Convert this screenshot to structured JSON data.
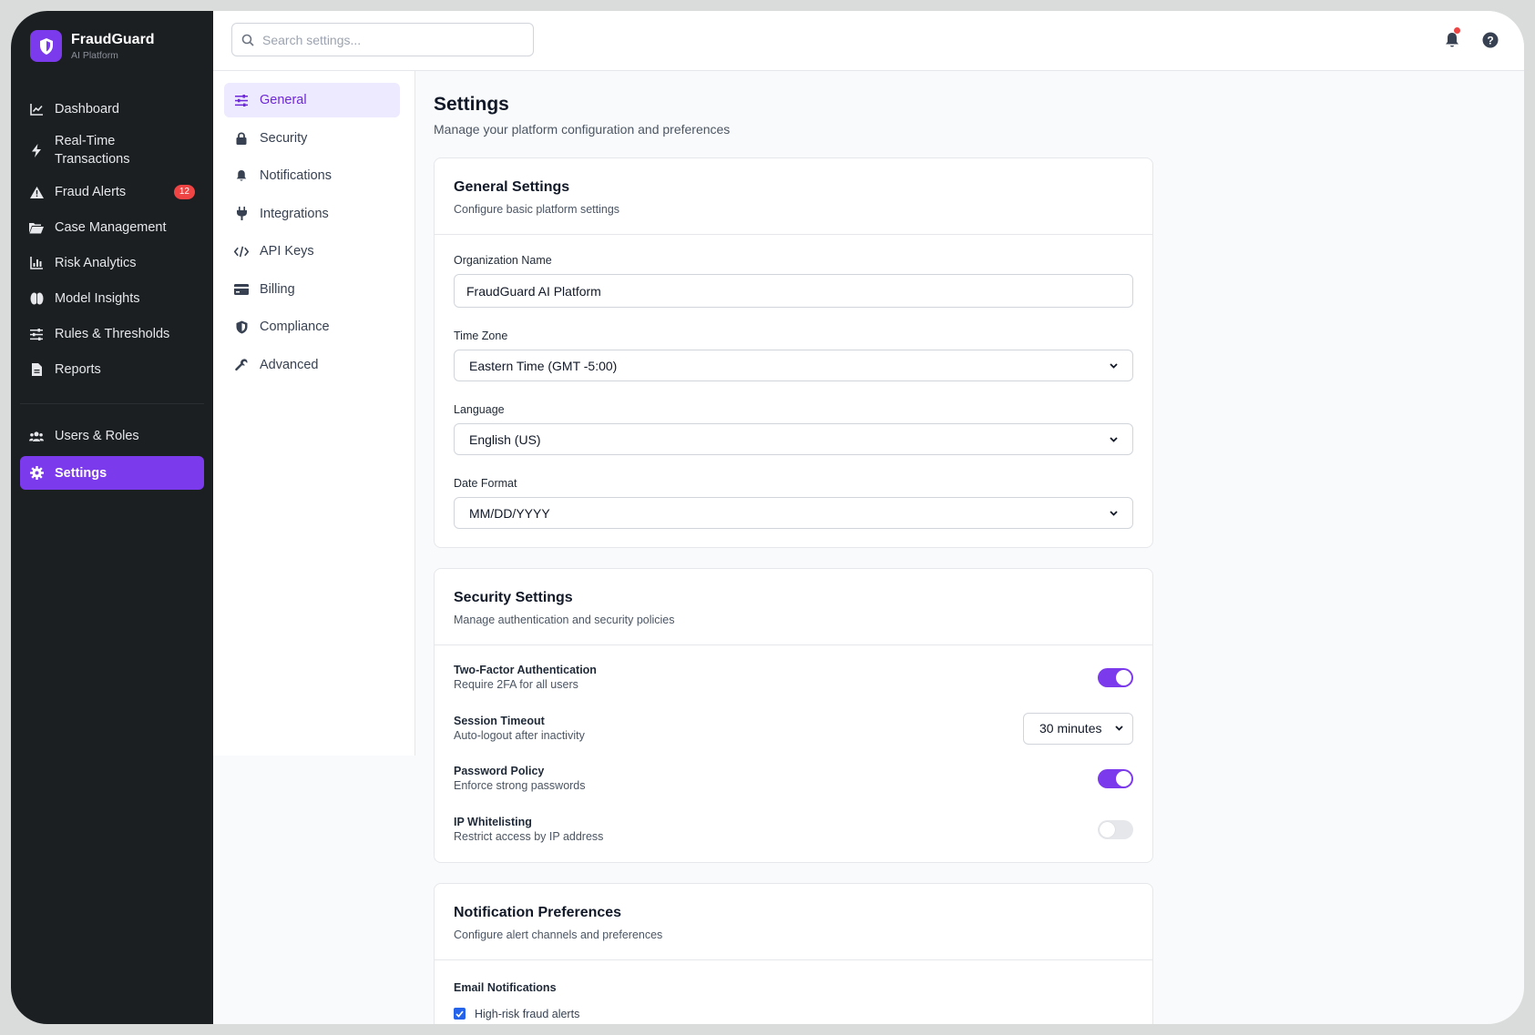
{
  "brand": {
    "name": "FraudGuard",
    "subtitle": "AI Platform"
  },
  "sidebar": {
    "items": [
      {
        "label": "Dashboard",
        "icon": "chart-line-icon"
      },
      {
        "label": "Real-Time\nTransactions",
        "icon": "bolt-icon"
      },
      {
        "label": "Fraud Alerts",
        "icon": "warning-icon",
        "badge": "12"
      },
      {
        "label": "Case Management",
        "icon": "folder-open-icon"
      },
      {
        "label": "Risk Analytics",
        "icon": "bar-chart-icon"
      },
      {
        "label": "Model Insights",
        "icon": "brain-icon"
      },
      {
        "label": "Rules & Thresholds",
        "icon": "sliders-icon"
      },
      {
        "label": "Reports",
        "icon": "file-icon"
      }
    ],
    "bottom_items": [
      {
        "label": "Users & Roles",
        "icon": "users-icon"
      },
      {
        "label": "Settings",
        "icon": "gear-icon",
        "active": true
      }
    ]
  },
  "topbar": {
    "search_placeholder": "Search settings..."
  },
  "settings_nav": {
    "items": [
      {
        "label": "General",
        "icon": "sliders-icon",
        "active": true
      },
      {
        "label": "Security",
        "icon": "lock-icon"
      },
      {
        "label": "Notifications",
        "icon": "bell-icon"
      },
      {
        "label": "Integrations",
        "icon": "plug-icon"
      },
      {
        "label": "API Keys",
        "icon": "code-icon"
      },
      {
        "label": "Billing",
        "icon": "credit-card-icon"
      },
      {
        "label": "Compliance",
        "icon": "shield-icon"
      },
      {
        "label": "Advanced",
        "icon": "wrench-icon"
      }
    ]
  },
  "page": {
    "title": "Settings",
    "subtitle": "Manage your platform configuration and preferences"
  },
  "general": {
    "title": "General Settings",
    "subtitle": "Configure basic platform settings",
    "org_label": "Organization Name",
    "org_value": "FraudGuard AI Platform",
    "timezone_label": "Time Zone",
    "timezone_value": "Eastern Time (GMT -5:00)",
    "language_label": "Language",
    "language_value": "English (US)",
    "date_format_label": "Date Format",
    "date_format_value": "MM/DD/YYYY"
  },
  "security": {
    "title": "Security Settings",
    "subtitle": "Manage authentication and security policies",
    "rows": [
      {
        "title": "Two-Factor Authentication",
        "desc": "Require 2FA for all users",
        "control": "toggle",
        "on": true
      },
      {
        "title": "Session Timeout",
        "desc": "Auto-logout after inactivity",
        "control": "select",
        "value": "30 minutes"
      },
      {
        "title": "Password Policy",
        "desc": "Enforce strong passwords",
        "control": "toggle",
        "on": true
      },
      {
        "title": "IP Whitelisting",
        "desc": "Restrict access by IP address",
        "control": "toggle",
        "on": false
      }
    ]
  },
  "notifications": {
    "title": "Notification Preferences",
    "subtitle": "Configure alert channels and preferences",
    "email_label": "Email Notifications",
    "options": [
      {
        "label": "High-risk fraud alerts",
        "checked": true
      }
    ]
  },
  "colors": {
    "accent": "#7c3aed",
    "sidebar_bg": "#1c1f22",
    "badge": "#ef4444",
    "checkbox": "#2563eb"
  }
}
